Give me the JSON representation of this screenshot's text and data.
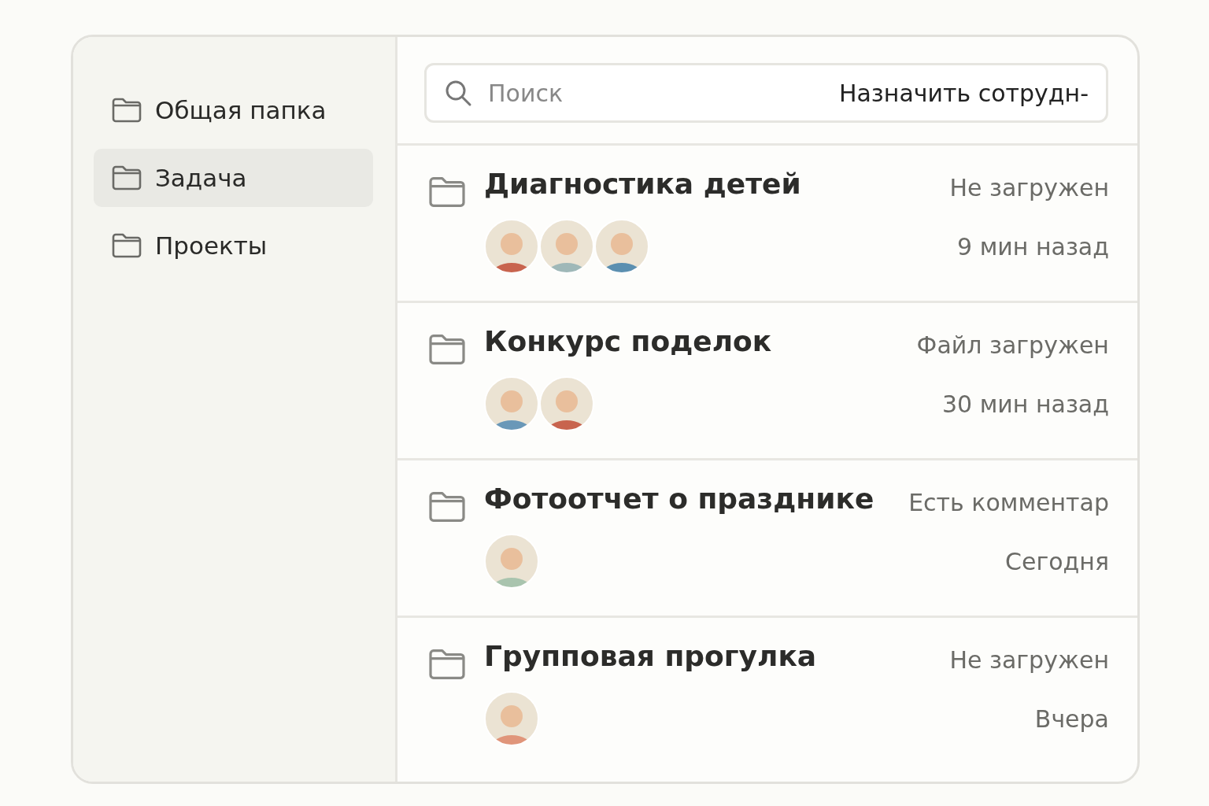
{
  "sidebar": {
    "items": [
      {
        "label": "Общая папка",
        "selected": false
      },
      {
        "label": "Задача",
        "selected": true
      },
      {
        "label": "Проекты",
        "selected": false
      }
    ]
  },
  "search": {
    "placeholder": "Поиск",
    "action": "Назначить сотрудн-"
  },
  "tasks": [
    {
      "title": "Диагностика детей",
      "status": "Не загружен",
      "time": "9 мин назад",
      "avatars": [
        {
          "color": "#c8644e"
        },
        {
          "color": "#9fb8b8"
        },
        {
          "color": "#5b8fb0"
        }
      ]
    },
    {
      "title": "Конкурс поделок",
      "status": "Файл загружен",
      "time": "30 мин назад",
      "avatars": [
        {
          "color": "#6a98b8"
        },
        {
          "color": "#c8644e"
        }
      ]
    },
    {
      "title": "Фотоотчет о празднике",
      "status": "Есть комментар",
      "time": "Сегодня",
      "avatars": [
        {
          "color": "#a9c4ae"
        }
      ]
    },
    {
      "title": "Групповая прогулка",
      "status": "Не загружен",
      "time": "Вчера",
      "avatars": [
        {
          "color": "#e0957a"
        }
      ]
    }
  ]
}
